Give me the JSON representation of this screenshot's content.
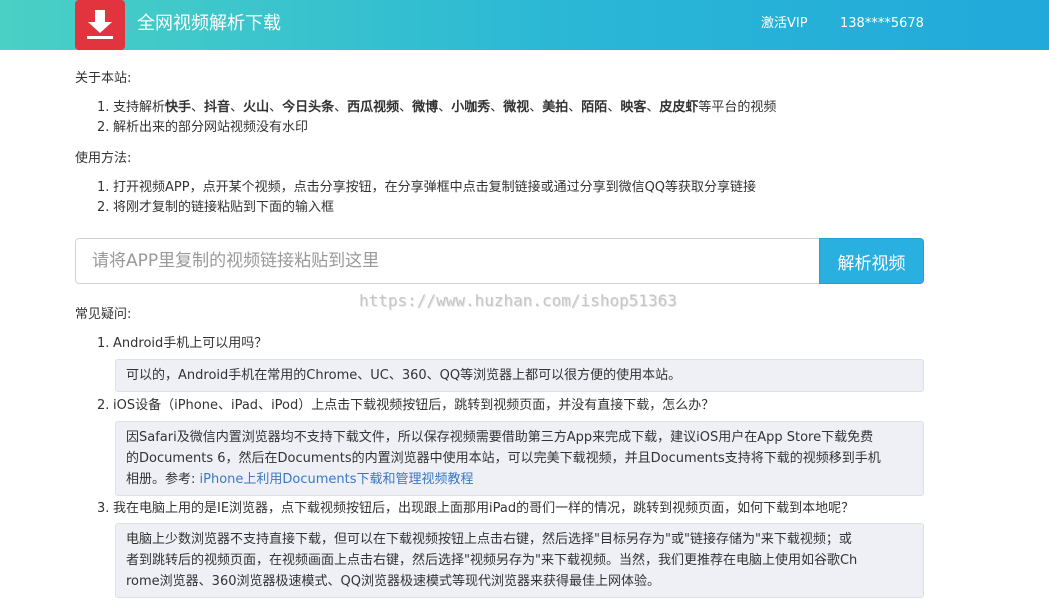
{
  "header": {
    "title": "全网视频解析下载",
    "vip_label": "激活VIP",
    "phone": "138****5678",
    "logo_icon": "download-icon",
    "colors": {
      "gradient_start": "#4ad0c4",
      "gradient_end": "#21a9da",
      "logo_bg": "#e2343e"
    }
  },
  "about": {
    "title": "关于本站:",
    "items": [
      {
        "num": "1.",
        "prefix": "支持解析",
        "platforms": [
          "快手",
          "抖音",
          "火山",
          "今日头条",
          "西瓜视频",
          "微博",
          "小咖秀",
          "微视",
          "美拍",
          "陌陌",
          "映客",
          "皮皮虾"
        ],
        "separator": "、",
        "suffix": "等平台的视频"
      },
      {
        "num": "2.",
        "text": "解析出来的部分网站视频没有水印"
      }
    ]
  },
  "usage": {
    "title": "使用方法:",
    "items": [
      {
        "num": "1.",
        "text": "打开视频APP，点开某个视频，点击分享按钮，在分享弹框中点击复制链接或通过分享到微信QQ等获取分享链接"
      },
      {
        "num": "2.",
        "text": "将刚才复制的链接粘贴到下面的输入框"
      }
    ]
  },
  "search": {
    "placeholder": "请将APP里复制的视频链接粘贴到这里",
    "value": "",
    "button_label": "解析视频",
    "button_color": "#2ab0e0"
  },
  "watermark": "https://www.huzhan.com/ishop51363",
  "faq": {
    "title": "常见疑问:",
    "items": [
      {
        "num": "1.",
        "question": "Android手机上可以用吗？",
        "answer_lines": [
          "可以的，Android手机在常用的Chrome、UC、360、QQ等浏览器上都可以很方便的使用本站。"
        ]
      },
      {
        "num": "2.",
        "question": "iOS设备（iPhone、iPad、iPod）上点击下载视频按钮后，跳转到视频页面，并没有直接下载，怎么办？",
        "answer_lines": [
          "因Safari及微信内置浏览器均不支持下载文件，所以保存视频需要借助第三方App来完成下载，建议iOS用户在App Store下载免费",
          "的Documents 6，然后在Documents的内置浏览器中使用本站，可以完美下载视频，并且Documents支持将下载的视频移到手机"
        ],
        "answer_last_prefix": "相册。参考: ",
        "answer_link": "iPhone上利用Documents下载和管理视频教程"
      },
      {
        "num": "3.",
        "question": "我在电脑上用的是IE浏览器，点下载视频按钮后，出现跟上面那用iPad的哥们一样的情况，跳转到视频页面，如何下载到本地呢？",
        "answer_lines": [
          "电脑上少数浏览器不支持直接下载，但可以在下载视频按钮上点击右键，然后选择\"目标另存为\"或\"链接存储为\"来下载视频；或",
          "者到跳转后的视频页面，在视频画面上点击右键，然后选择\"视频另存为\"来下载视频。当然，我们更推荐在电脑上使用如谷歌Ch",
          "rome浏览器、360浏览器极速模式、QQ浏览器极速模式等现代浏览器来获得最佳上网体验。"
        ]
      }
    ]
  }
}
